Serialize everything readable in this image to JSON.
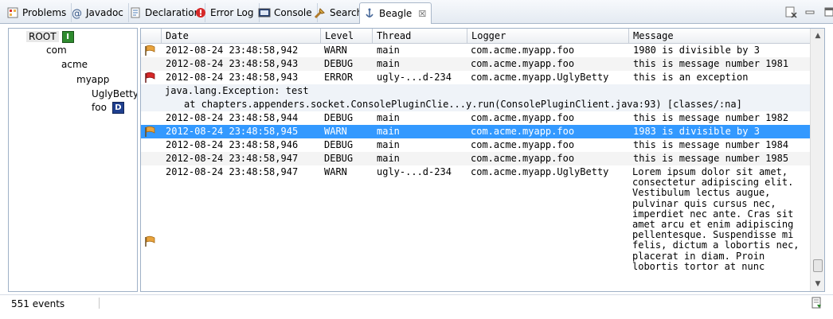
{
  "tabs": [
    {
      "label": "Problems",
      "icon": "problems-icon"
    },
    {
      "label": "Javadoc",
      "icon": "javadoc-icon"
    },
    {
      "label": "Declaration",
      "icon": "declaration-icon"
    },
    {
      "label": "Error Log",
      "icon": "error-log-icon"
    },
    {
      "label": "Console",
      "icon": "console-icon"
    },
    {
      "label": "Search",
      "icon": "search-icon"
    },
    {
      "label": "Beagle",
      "icon": "beagle-icon",
      "active": true,
      "close": "☒"
    }
  ],
  "tree": [
    {
      "label": "ROOT",
      "badge": "I",
      "badge_color": "#2e8b2e"
    },
    {
      "label": "com"
    },
    {
      "label": "acme"
    },
    {
      "label": "myapp"
    },
    {
      "label": "UglyBetty"
    },
    {
      "label": "foo",
      "badge": "D",
      "badge_color": "#1f3f8f"
    }
  ],
  "columns": [
    "Date",
    "Level",
    "Thread",
    "Logger",
    "Message"
  ],
  "rows": [
    {
      "date": "2012-08-24 23:48:58,942",
      "level": "WARN",
      "thread": "main",
      "logger": "com.acme.myapp.foo",
      "message": "1980 is divisible by 3",
      "flag": "warn"
    },
    {
      "date": "2012-08-24 23:48:58,943",
      "level": "DEBUG",
      "thread": "main",
      "logger": "com.acme.myapp.foo",
      "message": "this is message number 1981"
    },
    {
      "date": "2012-08-24 23:48:58,943",
      "level": "ERROR",
      "thread": "ugly-...d-234",
      "logger": "com.acme.myapp.UglyBetty",
      "message": "this is an exception",
      "flag": "error"
    },
    {
      "date": "2012-08-24 23:48:58,944",
      "level": "DEBUG",
      "thread": "main",
      "logger": "com.acme.myapp.foo",
      "message": "this is message number 1982"
    },
    {
      "date": "2012-08-24 23:48:58,945",
      "level": "WARN",
      "thread": "main",
      "logger": "com.acme.myapp.foo",
      "message": "1983 is divisible by 3",
      "flag": "warn",
      "selected": true
    },
    {
      "date": "2012-08-24 23:48:58,946",
      "level": "DEBUG",
      "thread": "main",
      "logger": "com.acme.myapp.foo",
      "message": "this is message number 1984"
    },
    {
      "date": "2012-08-24 23:48:58,947",
      "level": "DEBUG",
      "thread": "main",
      "logger": "com.acme.myapp.foo",
      "message": "this is message number 1985"
    },
    {
      "date": "2012-08-24 23:48:58,947",
      "level": "WARN",
      "thread": "ugly-...d-234",
      "logger": "com.acme.myapp.UglyBetty",
      "message": "Lorem ipsum dolor sit amet, consectetur adipiscing elit. Vestibulum lectus augue, pulvinar quis cursus nec, imperdiet nec ante. Cras sit amet arcu et enim adipiscing pellentesque. Suspendisse mi felis, dictum a lobortis nec, placerat in diam. Proin lobortis tortor at nunc",
      "flag": "warn"
    }
  ],
  "exception": {
    "line1": "java.lang.Exception: test",
    "line2": "at chapters.appenders.socket.ConsolePluginClie...y.run(ConsolePluginClient.java:93) [classes/:na]"
  },
  "status": {
    "events": "551 events"
  },
  "colors": {
    "selection": "#3399ff",
    "warn_flag": "#e8a33d",
    "error_flag": "#d62828"
  }
}
